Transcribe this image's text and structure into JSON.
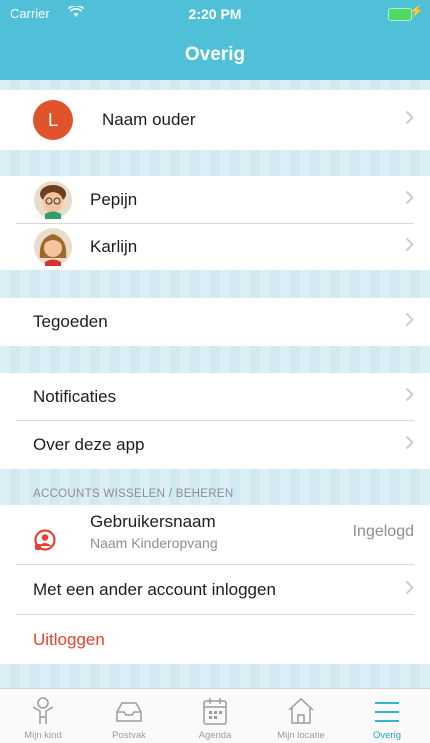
{
  "status_bar": {
    "carrier": "Carrier",
    "time": "2:20 PM"
  },
  "nav": {
    "title": "Overig"
  },
  "parent": {
    "initial": "L",
    "name": "Naam ouder"
  },
  "children": [
    {
      "name": "Pepijn"
    },
    {
      "name": "Karlijn"
    }
  ],
  "menu": {
    "tegoeden": "Tegoeden",
    "notificaties": "Notificaties",
    "over": "Over deze app"
  },
  "accounts": {
    "header": "ACCOUNTS WISSELEN / BEHEREN",
    "username": "Gebruikersnaam",
    "organization": "Naam Kinderopvang",
    "status": "Ingelogd",
    "other_login": "Met een ander account inloggen",
    "logout": "Uitloggen"
  },
  "tabs": [
    {
      "label": "Mijn kind",
      "icon": "child-icon"
    },
    {
      "label": "Postvak",
      "icon": "inbox-icon"
    },
    {
      "label": "Agenda",
      "icon": "calendar-icon"
    },
    {
      "label": "Mijn locatie",
      "icon": "home-icon"
    },
    {
      "label": "Overig",
      "icon": "menu-icon"
    }
  ],
  "colors": {
    "accent": "#4fc0d8",
    "tab_active": "#1aabd0",
    "logout": "#e8412f",
    "avatar": "#e0542b"
  }
}
